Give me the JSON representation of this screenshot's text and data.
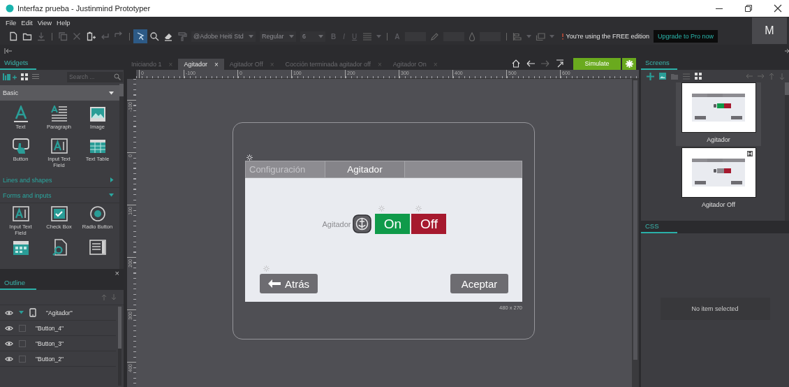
{
  "window": {
    "title": "Interfaz prueba - Justinmind Prototyper"
  },
  "menu": [
    "File",
    "Edit",
    "View",
    "Help"
  ],
  "toolbar": {
    "tool_groups": [
      [
        {
          "kind": "new",
          "selected": false,
          "disabled": false
        },
        {
          "kind": "open",
          "selected": false,
          "disabled": false
        },
        {
          "kind": "save",
          "selected": false,
          "disabled": true
        }
      ],
      [
        {
          "kind": "copy",
          "selected": false,
          "disabled": true
        },
        {
          "kind": "cut",
          "selected": false,
          "disabled": true
        },
        {
          "kind": "paste",
          "selected": false,
          "disabled": false
        },
        {
          "kind": "undo",
          "selected": false,
          "disabled": true
        },
        {
          "kind": "redo",
          "selected": false,
          "disabled": true
        }
      ],
      [
        {
          "kind": "pointer",
          "selected": true,
          "disabled": false
        },
        {
          "kind": "zoom",
          "selected": false,
          "disabled": false
        },
        {
          "kind": "eraser",
          "selected": false,
          "disabled": false
        },
        {
          "kind": "painter",
          "selected": false,
          "disabled": true
        }
      ]
    ],
    "font_family": "@Adobe Heiti Std",
    "font_style": "Regular",
    "font_size": "6",
    "format_buttons": [
      "B",
      "I",
      "U"
    ],
    "text_color_glyph": "A",
    "notice": "You're using the FREE edition",
    "upgrade": "Upgrade to Pro now",
    "avatar": "M"
  },
  "widgets_panel": {
    "tab": "Widgets",
    "search_placeholder": "Search ...",
    "sections": [
      {
        "title": "Basic",
        "kind": "dropdown",
        "expanded": true,
        "items": [
          {
            "kind": "text",
            "label": "Text"
          },
          {
            "kind": "paragraph",
            "label": "Paragraph"
          },
          {
            "kind": "image",
            "label": "Image"
          },
          {
            "kind": "button",
            "label": "Button"
          },
          {
            "kind": "input",
            "label": "Input Text Field"
          },
          {
            "kind": "table",
            "label": "Text Table"
          }
        ]
      },
      {
        "title": "Lines and shapes",
        "kind": "category",
        "expanded": false
      },
      {
        "title": "Forms and inputs",
        "kind": "category",
        "expanded": true,
        "items": [
          {
            "kind": "input",
            "label": "Input Text Field"
          },
          {
            "kind": "checkbox",
            "label": "Check Box"
          },
          {
            "kind": "radio",
            "label": "Radio Button"
          },
          {
            "kind": "calendar"
          },
          {
            "kind": "file"
          },
          {
            "kind": "list"
          }
        ]
      }
    ]
  },
  "outline_panel": {
    "tab": "Outline",
    "close": "×",
    "items": [
      {
        "label": "\"Agitador\"",
        "kind": "screen",
        "expanded": true,
        "children": [
          {
            "label": "\"Button_4\"",
            "kind": "widget"
          },
          {
            "label": "\"Button_3\"",
            "kind": "widget"
          },
          {
            "label": "\"Button_2\"",
            "kind": "widget"
          }
        ]
      }
    ]
  },
  "document_tabs": [
    {
      "label": "Iniciando 1",
      "close": "×",
      "selected": false
    },
    {
      "label": "Agitador",
      "close": "×",
      "selected": true
    },
    {
      "label": "Agitador Off",
      "close": "×",
      "selected": false
    },
    {
      "label": "Cocción terminada agitador off",
      "close": "×",
      "selected": false
    },
    {
      "label": "Agitador On",
      "close": "×",
      "selected": false
    }
  ],
  "simulate": "Simulate",
  "ruler": {
    "horizontal": [
      "0",
      "-100",
      "0",
      "100",
      "200",
      "300",
      "400",
      "500",
      "600"
    ],
    "vertical": [
      "-100",
      "0",
      "100",
      "200",
      "300",
      "400"
    ]
  },
  "prototype": {
    "header_tabs": [
      {
        "label": "Configuración",
        "selected": false
      },
      {
        "label": "Agitador",
        "selected": true
      }
    ],
    "control_label": "Agitador",
    "on": "On",
    "off": "Off",
    "back": "Atrás",
    "accept": "Aceptar",
    "size": "480 x 270"
  },
  "screens_panel": {
    "tab": "Screens",
    "thumbnails": [
      {
        "label": "Agitador",
        "selected": true,
        "on": true,
        "marked": false
      },
      {
        "label": "Agitador Off",
        "selected": false,
        "on": false,
        "marked": true
      }
    ]
  },
  "css_panel": {
    "tab": "CSS",
    "message": "No item selected"
  }
}
